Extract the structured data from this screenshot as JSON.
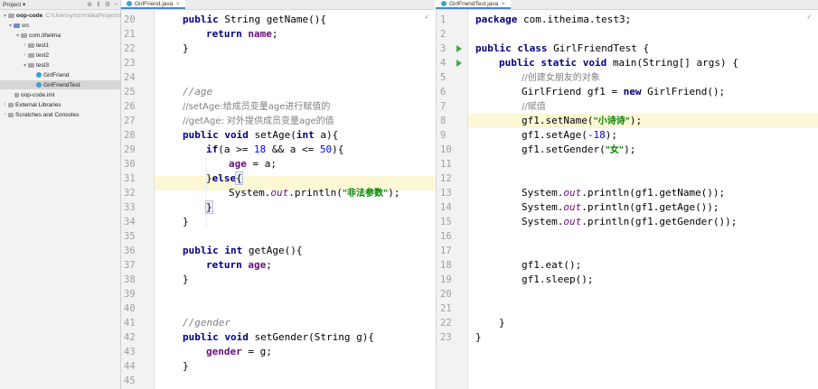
{
  "project": {
    "header": "Project",
    "items": [
      {
        "label": "oop-code",
        "path": "C:\\Users\\ymzxr\\IdeaProjects\\..."
      },
      {
        "label": "src"
      },
      {
        "label": "com.itheima"
      },
      {
        "label": "test1"
      },
      {
        "label": "test2"
      },
      {
        "label": "test3"
      },
      {
        "label": "GirlFriend"
      },
      {
        "label": "GirlFriendTest"
      },
      {
        "label": "oop-code.iml"
      },
      {
        "label": "External Libraries"
      },
      {
        "label": "Scratches and Consoles"
      }
    ]
  },
  "tabs": {
    "left": "GirlFriend.java",
    "right": "GirlFriendTest.java"
  },
  "left_editor": {
    "line_numbers": [
      "20",
      "21",
      "22",
      "23",
      "24",
      "25",
      "26",
      "27",
      "28",
      "29",
      "30",
      "31",
      "32",
      "33",
      "34",
      "35",
      "36",
      "37",
      "38",
      "39",
      "40",
      "41",
      "42",
      "43",
      "44",
      "45"
    ]
  },
  "right_editor": {
    "line_numbers": [
      "1",
      "2",
      "3",
      "4",
      "5",
      "6",
      "7",
      "8",
      "9",
      "10",
      "11",
      "12",
      "13",
      "14",
      "15",
      "16",
      "17",
      "18",
      "19",
      "20",
      "21",
      "22",
      "23"
    ]
  },
  "code": {
    "l20_a": "public",
    "l20_b": " String getName(){",
    "l21_a": "return",
    "l21_b": " name",
    "l21_c": ";",
    "l22": "}",
    "l25": "//age",
    "l26": "//setAge:给成员变量age进行赋值的",
    "l27": "//getAge: 对外提供成员变量age的值",
    "l28_a": "public void",
    "l28_b": " setAge(",
    "l28_c": "int",
    "l28_d": " a){",
    "l29_a": "if",
    "l29_b": "(a >= ",
    "l29_c": "18",
    "l29_d": " && a <= ",
    "l29_e": "50",
    "l29_f": "){",
    "l30_a": "age",
    "l30_b": " = a;",
    "l31_a": "}",
    "l31_b": "else",
    "l31_c": "{",
    "l32_a": "System.",
    "l32_b": "out",
    "l32_c": ".println(",
    "l32_d": "\"非法参数\"",
    "l32_e": ");",
    "l33": "}",
    "l34": "}",
    "l36_a": "public int",
    "l36_b": " getAge(){",
    "l37_a": "return",
    "l37_b": " age",
    "l37_c": ";",
    "l38": "}",
    "l41": "//gender",
    "l42_a": "public void",
    "l42_b": " setGender(String g){",
    "l43_a": "gender",
    "l43_b": " = g;",
    "l44": "}",
    "r1_a": "package",
    "r1_b": " com.itheima.test3;",
    "r3_a": "public class",
    "r3_b": " GirlFriendTest {",
    "r4_a": "public static void",
    "r4_b": " main(String[] args) {",
    "r5": "//创建女朋友的对象",
    "r6_a": "GirlFriend gf1 = ",
    "r6_b": "new",
    "r6_c": " GirlFriend();",
    "r7": "//赋值",
    "r8_a": "gf1.setName(",
    "r8_b": "\"小诗诗\"",
    "r8_c": ");",
    "r9_a": "gf1.setAge(",
    "r9_b": "-18",
    "r9_c": ");",
    "r10_a": "gf1.setGender(",
    "r10_b": "\"女\"",
    "r10_c": ");",
    "r13_a": "System.",
    "r13_b": "out",
    "r13_c": ".println(gf1.getName());",
    "r14_a": "System.",
    "r14_b": "out",
    "r14_c": ".println(gf1.getAge());",
    "r15_a": "System.",
    "r15_b": "out",
    "r15_c": ".println(gf1.getGender());",
    "r18": "gf1.eat();",
    "r19": "gf1.sleep();",
    "r22": "}",
    "r23": "}"
  },
  "colors": {
    "keyword": "#000080",
    "field": "#660e7a",
    "comment": "#808080",
    "string": "#008000",
    "number": "#0000ff",
    "current_line": "#fcf8d6",
    "run_icon": "#4aa84a"
  }
}
